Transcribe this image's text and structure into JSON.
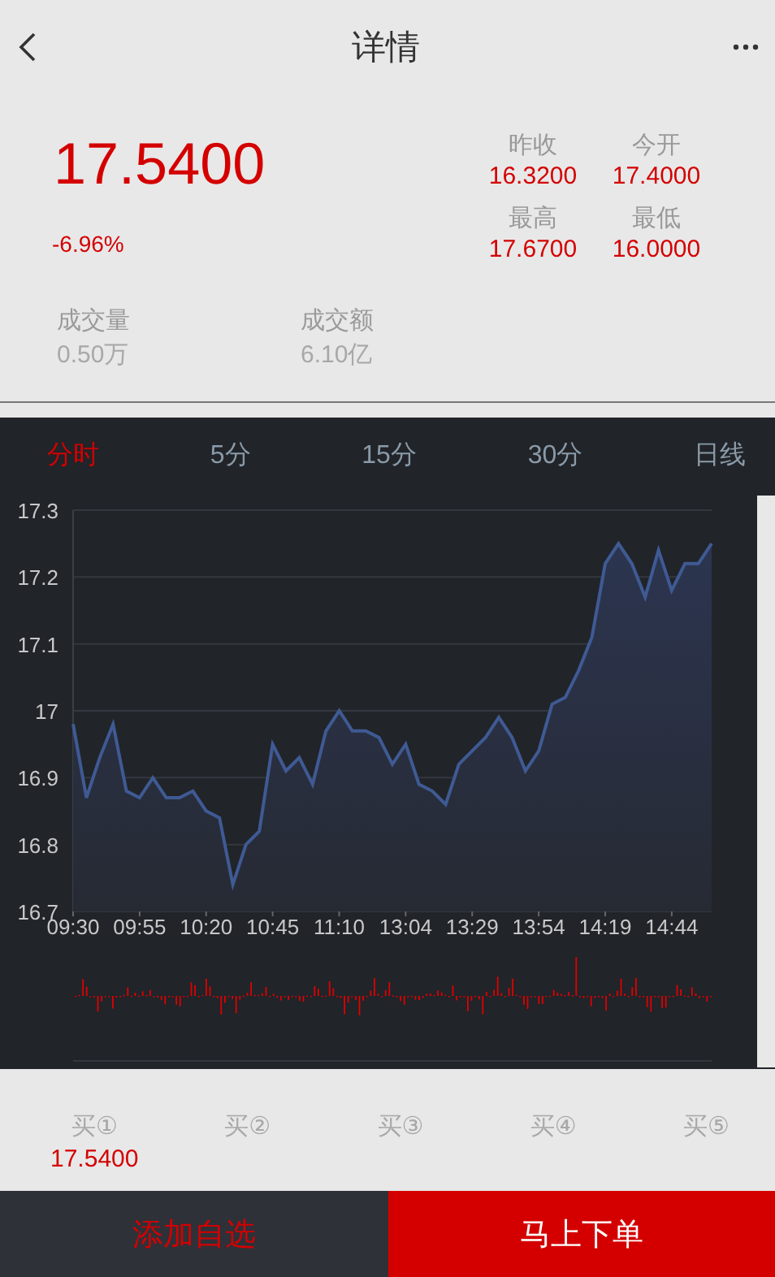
{
  "header": {
    "title": "详情"
  },
  "quote": {
    "price": "17.5400",
    "change": "-6.96%",
    "stats": [
      {
        "label": "昨收",
        "value": "16.3200"
      },
      {
        "label": "今开",
        "value": "17.4000"
      },
      {
        "label": "最高",
        "value": "17.6700"
      },
      {
        "label": "最低",
        "value": "16.0000"
      }
    ],
    "volume": [
      {
        "label": "成交量",
        "value": "0.50万"
      },
      {
        "label": "成交额",
        "value": "6.10亿"
      }
    ]
  },
  "periods": [
    {
      "label": "分时",
      "selected": true
    },
    {
      "label": "5分",
      "selected": false
    },
    {
      "label": "15分",
      "selected": false
    },
    {
      "label": "30分",
      "selected": false
    },
    {
      "label": "日线",
      "selected": false
    }
  ],
  "chart_data": {
    "type": "area",
    "grid": true,
    "ylim": [
      16.7,
      17.3
    ],
    "yticks": [
      16.7,
      16.8,
      16.9,
      {
        "value": 17,
        "label": "17"
      },
      17.1,
      17.2,
      17.3
    ],
    "categories": [
      "09:30",
      null,
      null,
      null,
      null,
      "09:55",
      null,
      null,
      null,
      null,
      "10:20",
      null,
      null,
      null,
      null,
      "10:45",
      null,
      null,
      null,
      null,
      "11:10",
      null,
      null,
      null,
      null,
      "13:04",
      null,
      null,
      null,
      null,
      "13:29",
      null,
      null,
      null,
      null,
      "13:54",
      null,
      null,
      null,
      null,
      "14:19",
      null,
      null,
      null,
      null,
      "14:44",
      null,
      null,
      null
    ],
    "series": [
      {
        "color": "#3f5a94",
        "values": [
          16.98,
          16.87,
          16.93,
          16.98,
          16.88,
          16.87,
          16.9,
          16.87,
          16.87,
          16.88,
          16.85,
          16.84,
          16.74,
          16.8,
          16.82,
          16.95,
          16.91,
          16.93,
          16.89,
          16.97,
          17.0,
          16.97,
          16.97,
          16.96,
          16.92,
          16.95,
          16.89,
          16.88,
          16.86,
          16.92,
          16.94,
          16.96,
          16.99,
          16.96,
          16.91,
          16.94,
          17.01,
          17.02,
          17.06,
          17.11,
          17.22,
          17.25,
          17.22,
          17.17,
          17.24,
          17.18,
          17.22,
          17.22,
          17.25
        ]
      }
    ]
  },
  "order_book": {
    "levels": [
      {
        "label": "买①"
      },
      {
        "label": "买②"
      },
      {
        "label": "买③"
      },
      {
        "label": "买④"
      },
      {
        "label": "买⑤"
      }
    ],
    "price": "17.5400"
  },
  "actions": [
    {
      "label": "添加自选",
      "kind": "secondary"
    },
    {
      "label": "马上下单",
      "kind": "primary"
    }
  ]
}
